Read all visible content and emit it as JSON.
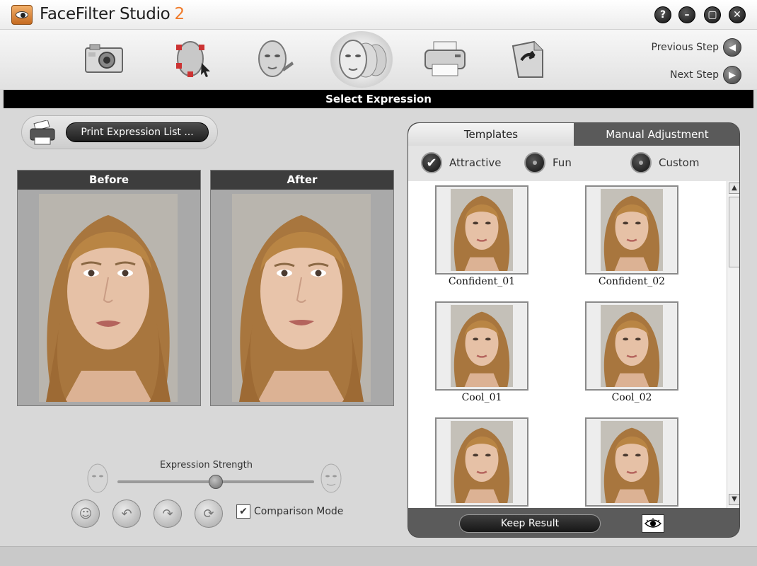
{
  "app": {
    "title": "FaceFilter Studio",
    "version": "2"
  },
  "window_controls": [
    {
      "name": "help-button",
      "glyph": "?"
    },
    {
      "name": "minimize-button",
      "glyph": "–"
    },
    {
      "name": "maximize-button",
      "glyph": "▢"
    },
    {
      "name": "close-button",
      "glyph": "✕"
    }
  ],
  "toolbar": {
    "tools": [
      "camera-icon",
      "face-mapping-icon",
      "face-edit-icon",
      "expression-faces-icon",
      "printer-icon",
      "export-icon"
    ],
    "active_tool": "expression-faces-icon",
    "previous_step": "Previous Step",
    "next_step": "Next Step"
  },
  "section": {
    "title": "Select Expression"
  },
  "print": {
    "label": "Print Expression List ..."
  },
  "panels": {
    "before": "Before",
    "after": "After"
  },
  "strength": {
    "label": "Expression Strength",
    "value": 0.5
  },
  "comparison": {
    "label": "Comparison Mode",
    "checked": true
  },
  "right": {
    "tabs": {
      "templates": "Templates",
      "manual": "Manual Adjustment"
    },
    "filters": [
      {
        "label": "Attractive",
        "selected": true
      },
      {
        "label": "Fun",
        "selected": false
      },
      {
        "label": "Custom",
        "selected": false
      }
    ],
    "templates": [
      "Confident_01",
      "Confident_02",
      "Cool_01",
      "Cool_02",
      "",
      ""
    ],
    "keep_result": "Keep Result"
  },
  "colors": {
    "accent": "#f07b2a",
    "dark": "#000000",
    "panel": "#5e5e5e"
  }
}
